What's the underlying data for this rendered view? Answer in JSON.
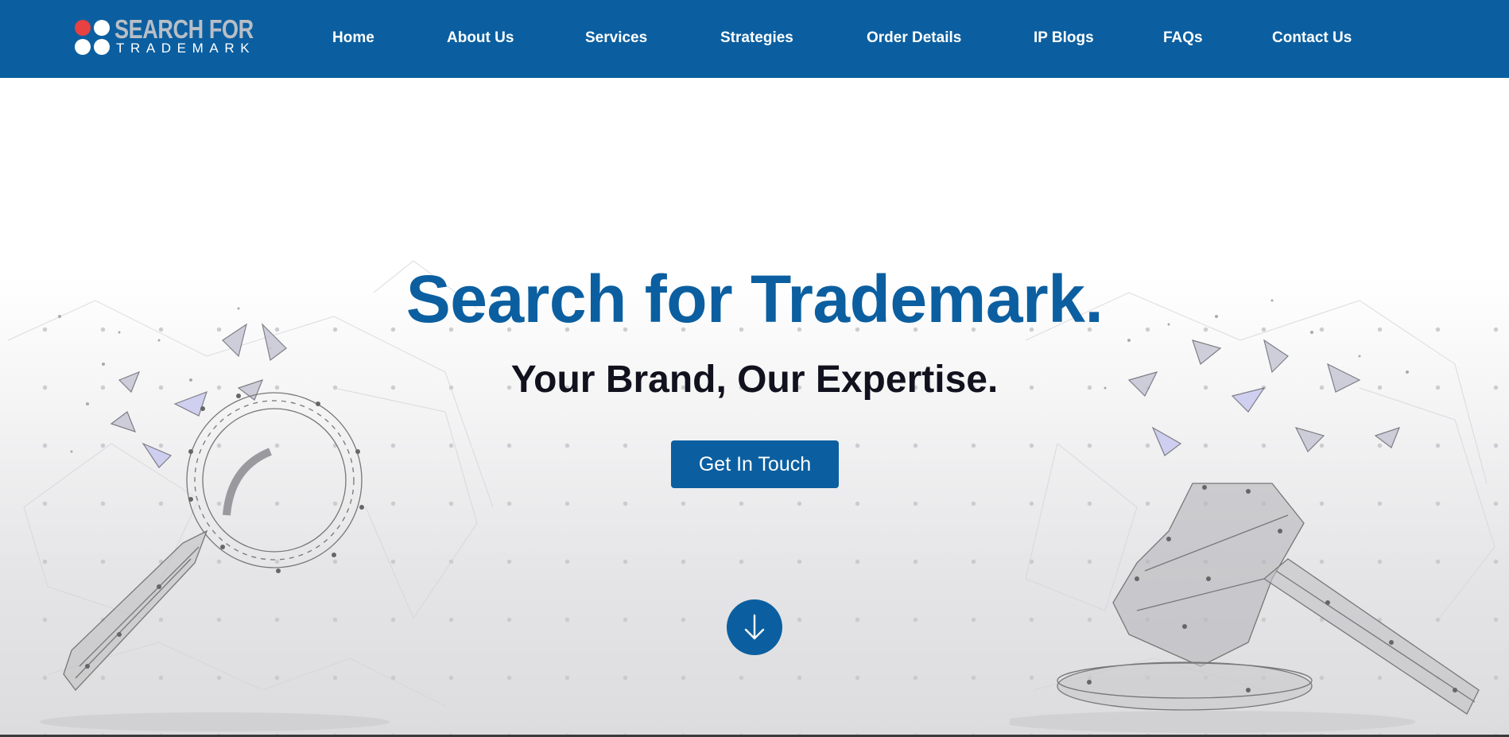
{
  "brand": {
    "logo_line_1": "SEARCH FOR",
    "logo_line_2": "TRADEMARK",
    "primary_color": "#0b5fa0",
    "accent_dot_color": "#e74141"
  },
  "nav": {
    "items": [
      {
        "label": "Home"
      },
      {
        "label": "About Us"
      },
      {
        "label": "Services"
      },
      {
        "label": "Strategies"
      },
      {
        "label": "Order Details"
      },
      {
        "label": "IP Blogs"
      },
      {
        "label": "FAQs"
      },
      {
        "label": "Contact Us"
      }
    ]
  },
  "hero": {
    "title": "Search for Trademark.",
    "subtitle": "Your Brand, Our Expertise.",
    "cta_label": "Get In Touch",
    "scroll_icon": "arrow-down-icon",
    "left_illustration": "magnifying-glass-icon",
    "right_illustration": "gavel-icon"
  }
}
